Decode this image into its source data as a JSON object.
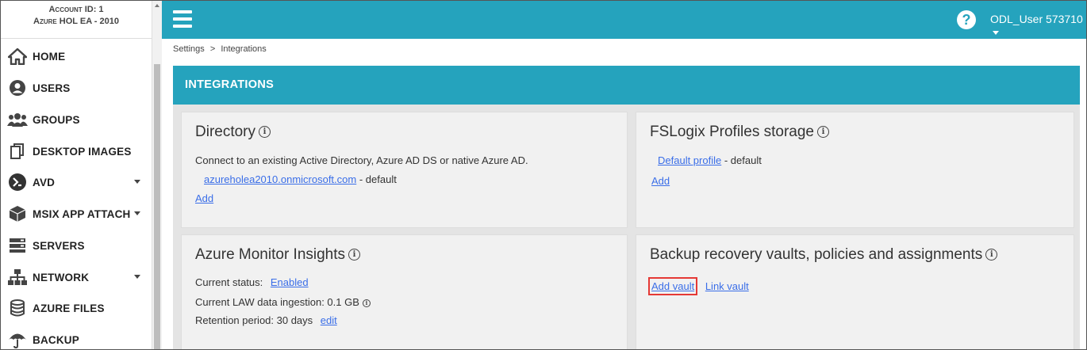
{
  "account": {
    "id_line": "Account ID: 1",
    "name_line": "Azure HOL EA - 2010"
  },
  "sidebar": {
    "items": [
      {
        "label": "HOME",
        "icon": "home-icon",
        "caret": false
      },
      {
        "label": "USERS",
        "icon": "user-icon",
        "caret": false
      },
      {
        "label": "GROUPS",
        "icon": "users-group-icon",
        "caret": false
      },
      {
        "label": "DESKTOP IMAGES",
        "icon": "copy-icon",
        "caret": false
      },
      {
        "label": "AVD",
        "icon": "avd-icon",
        "caret": true
      },
      {
        "label": "MSIX APP ATTACH",
        "icon": "box-icon",
        "caret": true
      },
      {
        "label": "SERVERS",
        "icon": "server-icon",
        "caret": false
      },
      {
        "label": "NETWORK",
        "icon": "network-icon",
        "caret": true
      },
      {
        "label": "AZURE FILES",
        "icon": "database-icon",
        "caret": false
      },
      {
        "label": "BACKUP",
        "icon": "umbrella-icon",
        "caret": false
      }
    ]
  },
  "topbar": {
    "help": "?",
    "user": "ODL_User 573710"
  },
  "breadcrumb": {
    "parent": "Settings",
    "sep": ">",
    "current": "Integrations"
  },
  "section": {
    "title": "INTEGRATIONS"
  },
  "cards": {
    "directory": {
      "title": "Directory",
      "desc": "Connect to an existing Active Directory, Azure AD DS or native Azure AD.",
      "domain_link": "azureholea2010.onmicrosoft.com",
      "domain_suffix": "- default",
      "add": "Add"
    },
    "fslogix": {
      "title": "FSLogix Profiles storage",
      "profile_link": "Default profile",
      "profile_suffix": "- default",
      "add": "Add"
    },
    "monitor": {
      "title": "Azure Monitor Insights",
      "status_label": "Current status:",
      "status_link": "Enabled",
      "law_label": "Current LAW data ingestion: 0.1 GB",
      "retention_label": "Retention period: 30 days",
      "edit": "edit"
    },
    "backup": {
      "title": "Backup recovery vaults, policies and assignments",
      "add_vault": "Add vault",
      "link_vault": "Link vault"
    }
  },
  "colors": {
    "accent": "#25a3bd",
    "link": "#3a6ee8",
    "highlight": "#e53935"
  }
}
